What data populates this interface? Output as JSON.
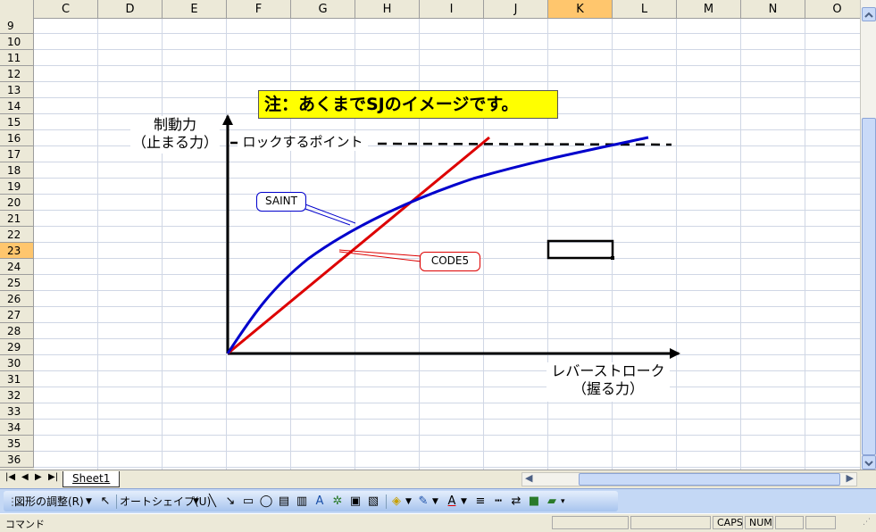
{
  "columns": [
    "C",
    "D",
    "E",
    "F",
    "G",
    "H",
    "I",
    "J",
    "K",
    "L",
    "M",
    "N",
    "O"
  ],
  "selected_column": "K",
  "rows": [
    "9",
    "10",
    "11",
    "12",
    "13",
    "14",
    "15",
    "16",
    "17",
    "18",
    "19",
    "20",
    "21",
    "22",
    "23",
    "24",
    "25",
    "26",
    "27",
    "28",
    "29",
    "30",
    "31",
    "32",
    "33",
    "34",
    "35",
    "36"
  ],
  "selected_row": "23",
  "note": "注：あくまでSJのイメージです。",
  "y_axis_label_line1": "制動力",
  "y_axis_label_line2": "（止まる力）",
  "x_axis_label_line1": "レバーストローク",
  "x_axis_label_line2": "（握る力）",
  "lock_point_label": "ロックするポイント",
  "callout_saint": "SAINT",
  "callout_code5": "CODE5",
  "colors": {
    "saint": "#0000cc",
    "code5": "#dd0000",
    "note_bg": "#ffff00"
  },
  "sheet_tab": "Sheet1",
  "drawing_toolbar": {
    "draw_menu": "図形の調整(R)",
    "autoshape_menu": "オートシェイプ(U)"
  },
  "status": {
    "mode": "コマンド",
    "caps": "CAPS",
    "num": "NUM"
  }
}
